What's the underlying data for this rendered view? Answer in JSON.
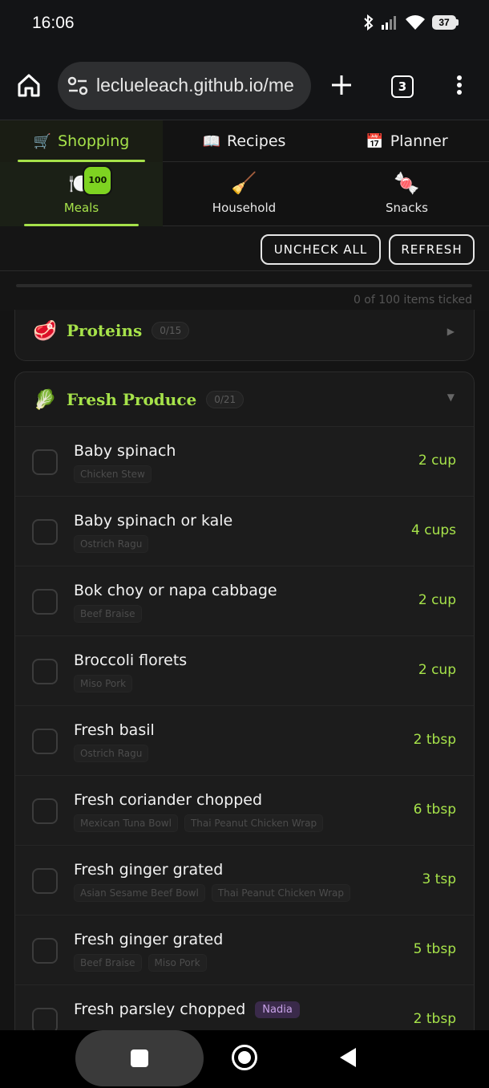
{
  "status": {
    "time": "16:06",
    "battery": "37"
  },
  "browser": {
    "url": "leclueleach.github.io/me",
    "tab_count": "3"
  },
  "top_tabs": [
    {
      "emoji": "🛒",
      "label": "Shopping"
    },
    {
      "emoji": "📖",
      "label": "Recipes"
    },
    {
      "emoji": "📅",
      "label": "Planner"
    }
  ],
  "sub_tabs": [
    {
      "emoji": "🍽️",
      "label": "Meals",
      "badge": "100"
    },
    {
      "emoji": "🧹",
      "label": "Household"
    },
    {
      "emoji": "🍬",
      "label": "Snacks"
    }
  ],
  "actions": {
    "uncheck_all": "UNCHECK ALL",
    "refresh": "REFRESH"
  },
  "progress": {
    "text": "0 of 100 items ticked",
    "fraction": 0
  },
  "categories": {
    "proteins": {
      "emoji": "🥩",
      "name": "Proteins",
      "count": "0/15",
      "chevron": "▶"
    },
    "produce": {
      "emoji": "🥬",
      "name": "Fresh Produce",
      "count": "0/21",
      "chevron": "▼"
    }
  },
  "items": [
    {
      "name": "Baby spinach",
      "tags": [
        "Chicken Stew"
      ],
      "qty": "2 cup"
    },
    {
      "name": "Baby spinach or kale",
      "tags": [
        "Ostrich Ragu"
      ],
      "qty": "4 cups"
    },
    {
      "name": "Bok choy or napa cabbage",
      "tags": [
        "Beef Braise"
      ],
      "qty": "2 cup"
    },
    {
      "name": "Broccoli florets",
      "tags": [
        "Miso Pork"
      ],
      "qty": "2 cup"
    },
    {
      "name": "Fresh basil",
      "tags": [
        "Ostrich Ragu"
      ],
      "qty": "2 tbsp"
    },
    {
      "name": "Fresh coriander chopped",
      "tags": [
        "Mexican Tuna Bowl",
        "Thai Peanut Chicken Wrap"
      ],
      "qty": "6 tbsp"
    },
    {
      "name": "Fresh ginger grated",
      "tags": [
        "Asian Sesame Beef Bowl",
        "Thai Peanut Chicken Wrap"
      ],
      "qty": "3 tsp"
    },
    {
      "name": "Fresh ginger grated",
      "tags": [
        "Beef Braise",
        "Miso Pork"
      ],
      "qty": "5 tbsp"
    },
    {
      "name": "Fresh parsley chopped",
      "tags": [],
      "qty": "2 tbsp",
      "who": "Nadia"
    }
  ]
}
